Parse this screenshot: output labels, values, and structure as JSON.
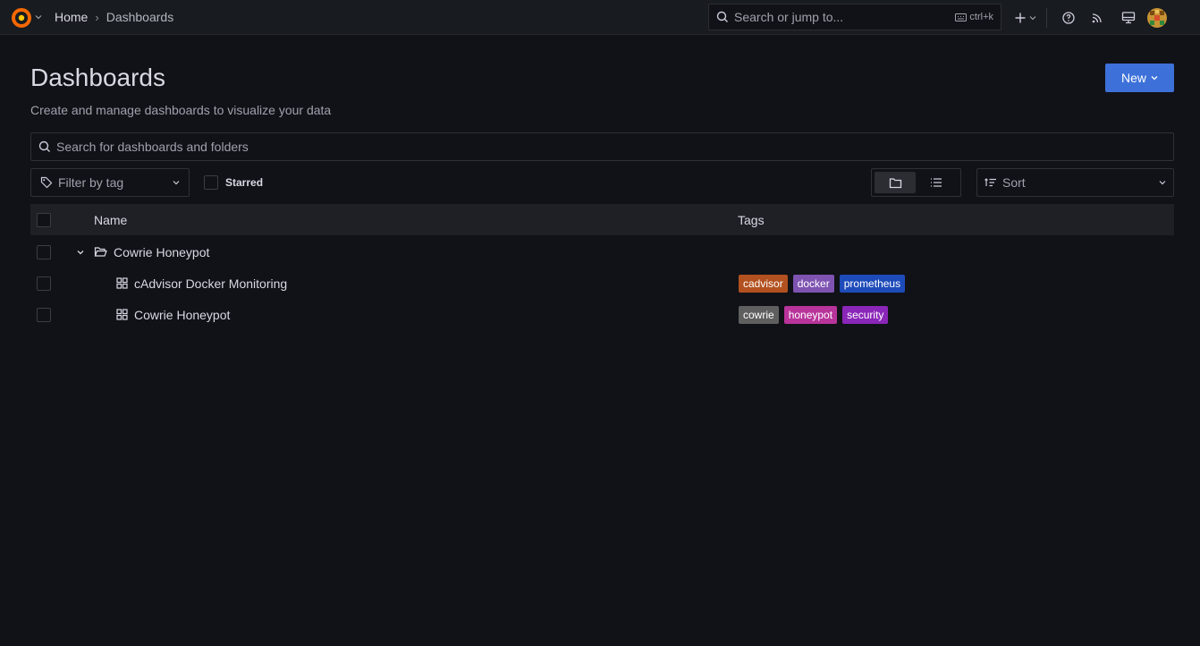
{
  "topbar": {
    "breadcrumb": {
      "home": "Home",
      "separator": "›",
      "current": "Dashboards"
    },
    "search_placeholder": "Search or jump to...",
    "shortcut": "ctrl+k"
  },
  "header": {
    "title": "Dashboards",
    "subtitle": "Create and manage dashboards to visualize your data",
    "new_button": "New"
  },
  "search": {
    "placeholder": "Search for dashboards and folders"
  },
  "filters": {
    "tag_placeholder": "Filter by tag",
    "starred_label": "Starred",
    "sort_placeholder": "Sort",
    "view_mode": "folders"
  },
  "table": {
    "columns": {
      "name": "Name",
      "tags": "Tags"
    },
    "folder": {
      "name": "Cowrie Honeypot",
      "expanded": true
    },
    "rows": [
      {
        "name": "cAdvisor Docker Monitoring",
        "tags": [
          {
            "label": "cadvisor",
            "color": "#b2511f"
          },
          {
            "label": "docker",
            "color": "#7e53b1"
          },
          {
            "label": "prometheus",
            "color": "#1e4bba"
          }
        ]
      },
      {
        "name": "Cowrie Honeypot",
        "tags": [
          {
            "label": "cowrie",
            "color": "#5f5f5f"
          },
          {
            "label": "honeypot",
            "color": "#b8349a"
          },
          {
            "label": "security",
            "color": "#8a26b8"
          }
        ]
      }
    ]
  },
  "colors": {
    "accent": "#3d71d9",
    "background": "#111217",
    "topbar": "#181b1f"
  }
}
